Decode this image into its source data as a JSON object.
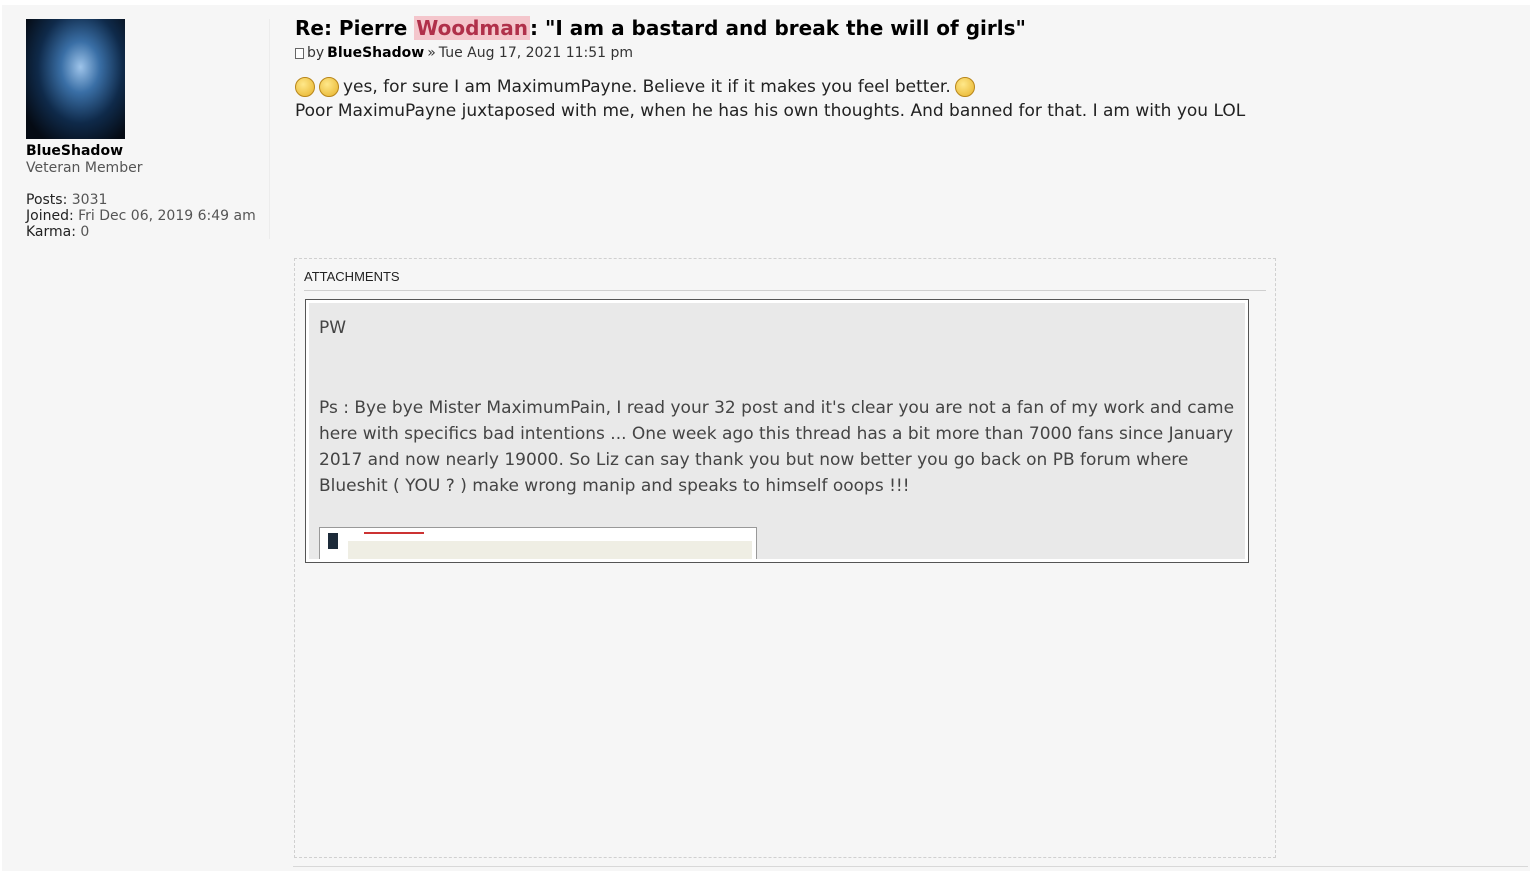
{
  "profile": {
    "username": "BlueShadow",
    "rank": "Veteran Member",
    "posts_label": "Posts:",
    "posts_value": "3031",
    "joined_label": "Joined:",
    "joined_value": "Fri Dec 06, 2019 6:49 am",
    "karma_label": "Karma:",
    "karma_value": "0"
  },
  "post": {
    "title_prefix": "Re: Pierre ",
    "title_highlight": "Woodman",
    "title_suffix": ": \"I am a bastard and break the will of girls\"",
    "by_label": "by",
    "author": "BlueShadow",
    "separator": "»",
    "timestamp": "Tue Aug 17, 2021 11:51 pm",
    "line1": "yes, for sure I am MaximumPayne. Believe it if it makes you feel better.",
    "line2": "Poor MaximuPayne juxtaposed with me, when he has his own thoughts. And banned for that. I am with you LOL"
  },
  "attachments": {
    "header": "ATTACHMENTS",
    "image_text_pw": "PW",
    "image_text_ps": "Ps : Bye bye Mister MaximumPain, I read your 32 post and it's clear you are not a fan of my work and came here with specifics bad intentions ... One week ago this thread has a bit more than 7000 fans since January 2017 and now nearly 19000. So Liz can say thank you but now better you go back on PB forum where Blueshit ( YOU ? ) make wrong manip and speaks to himself ooops !!!"
  },
  "icons": {
    "smiley": "grinning-smiley-icon",
    "post": "post-page-icon"
  },
  "colors": {
    "highlight_bg": "#f4c6cc",
    "highlight_text": "#b0304a"
  }
}
